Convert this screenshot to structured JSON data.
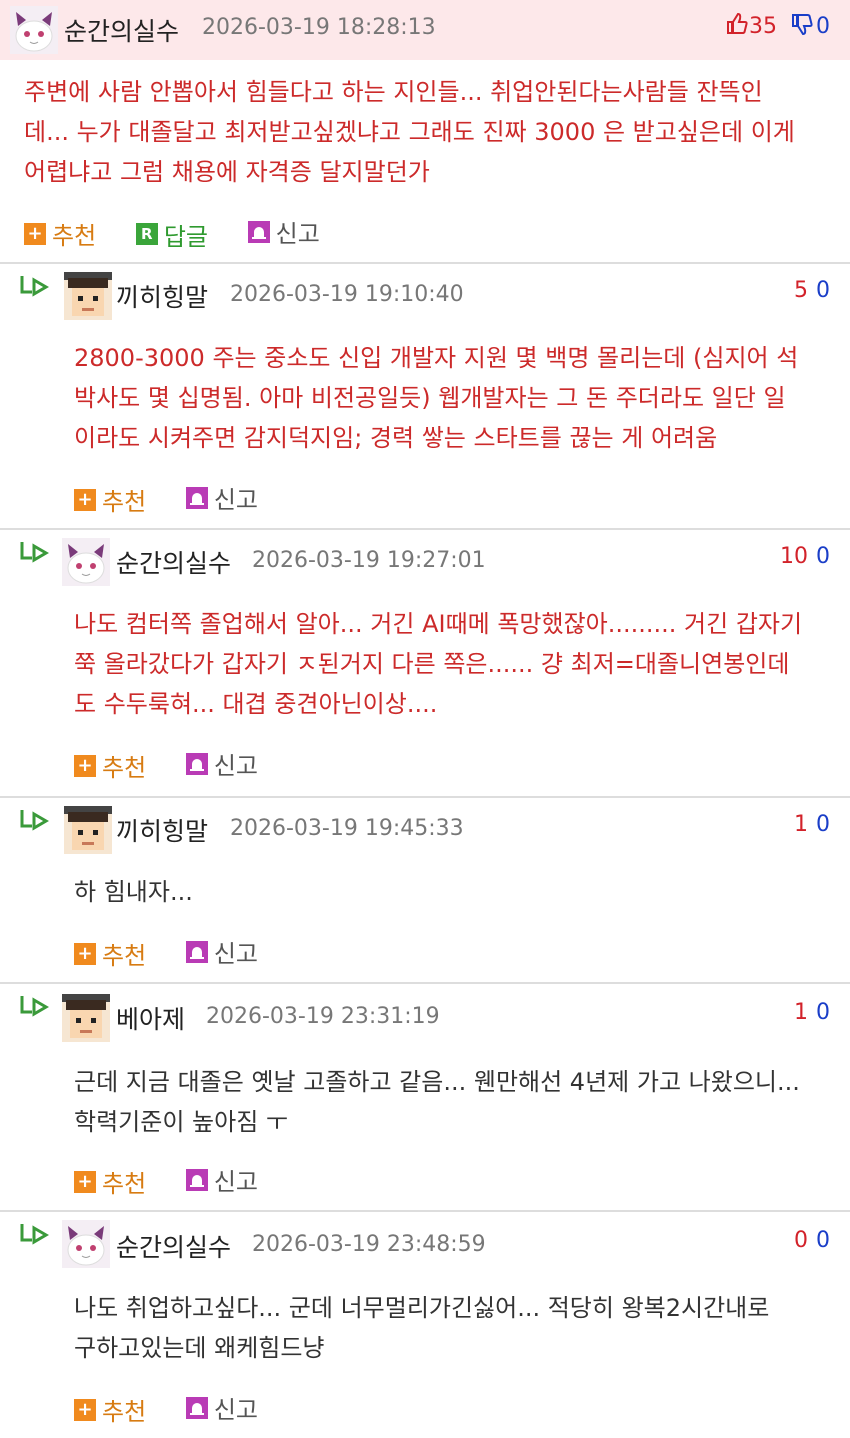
{
  "actions": {
    "recommend": "추천",
    "reply": "답글",
    "report": "신고",
    "r_glyph": "R"
  },
  "comments": [
    {
      "nick": "순간의실수",
      "time": "2026-03-19 18:28:13",
      "up": "35",
      "down": "0",
      "text": "주변에 사람 안뽑아서 힘들다고 하는 지인들... 취업안된다는사람들 잔뜩인\n데... 누가 대졸달고 최저받고싶겠냐고 그래도 진짜 3000 은 받고싶은데 이게\n어렵냐고 그럼 채용에 자격증 달지말던가"
    },
    {
      "nick": "끼히힝말",
      "time": "2026-03-19 19:10:40",
      "up": "5",
      "down": "0",
      "text": "2800-3000 주는 중소도 신입 개발자 지원 몇 백명 몰리는데 (심지어 석\n박사도 몇 십명됨. 아마 비전공일듯) 웹개발자는 그 돈 주더라도 일단 일\n이라도 시켜주면 감지덕지임; 경력 쌓는 스타트를 끊는 게 어려움"
    },
    {
      "nick": "순간의실수",
      "time": "2026-03-19 19:27:01",
      "up": "10",
      "down": "0",
      "text": "나도 컴터쪽 졸업해서 알아... 거긴 AI때메 폭망했잖아......... 거긴 갑자기\n쭉 올라갔다가 갑자기 ㅈ된거지 다른 쪽은...... 걍 최저=대졸니연봉인데\n도 수두룩혀... 대겹 중견아닌이상...."
    },
    {
      "nick": "끼히힝말",
      "time": "2026-03-19 19:45:33",
      "up": "1",
      "down": "0",
      "text": "하 힘내자..."
    },
    {
      "nick": "베아제",
      "time": "2026-03-19 23:31:19",
      "up": "1",
      "down": "0",
      "text": "근데 지금 대졸은 옛날 고졸하고 같음... 웬만해선 4년제 가고 나왔으니...\n학력기준이 높아짐 ㅜ"
    },
    {
      "nick": "순간의실수",
      "time": "2026-03-19 23:48:59",
      "up": "0",
      "down": "0",
      "text": "나도 취업하고싶다... 군데 너무멀리가긴싫어... 적당히 왕복2시간내로\n구하고있는데 왜케힘드냥"
    }
  ]
}
